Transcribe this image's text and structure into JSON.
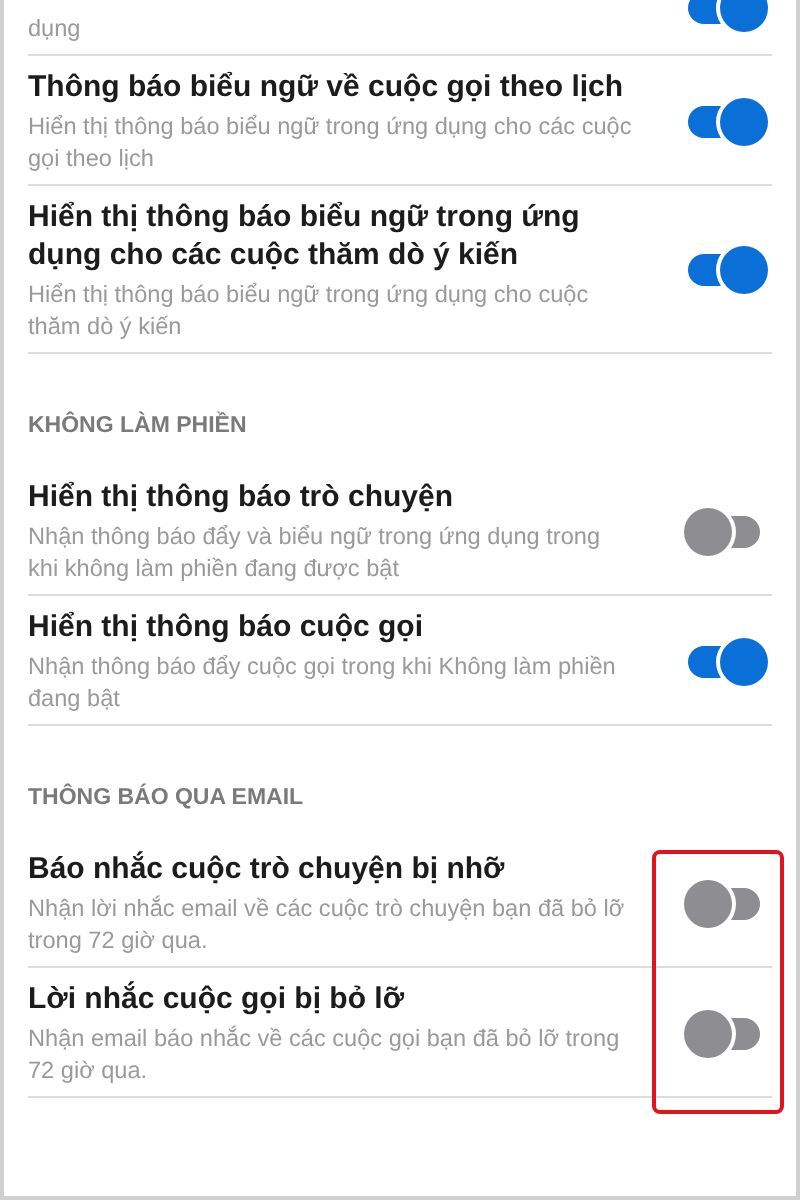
{
  "sections": [
    {
      "highlight_toggles": false,
      "rows": [
        {
          "title": null,
          "description": "dụng",
          "on": true
        },
        {
          "title": "Thông báo biểu ngữ về cuộc gọi theo lịch",
          "description": "Hiển thị thông báo biểu ngữ trong ứng dụng cho các cuộc gọi theo lịch",
          "on": true
        },
        {
          "title": "Hiển thị thông báo biểu ngữ trong ứng dụng cho các cuộc thăm dò ý kiến",
          "description": "Hiển thị thông báo biểu ngữ trong ứng dụng cho cuộc thăm dò ý kiến",
          "on": true
        }
      ]
    },
    {
      "header": "KHÔNG LÀM PHIỀN",
      "highlight_toggles": false,
      "rows": [
        {
          "title": "Hiển thị thông báo trò chuyện",
          "description": "Nhận thông báo đẩy và biểu ngữ trong ứng dụng trong khi không làm phiền đang được bật",
          "on": false
        },
        {
          "title": "Hiển thị thông báo cuộc gọi",
          "description": "Nhận thông báo đẩy cuộc gọi trong khi Không làm phiền đang bật",
          "on": true
        }
      ]
    },
    {
      "header": "THÔNG BÁO QUA EMAIL",
      "highlight_toggles": true,
      "rows": [
        {
          "title": "Báo nhắc cuộc trò chuyện bị nhỡ",
          "description": "Nhận lời nhắc email về các cuộc trò chuyện bạn đã bỏ lỡ trong 72 giờ qua.",
          "on": false
        },
        {
          "title": "Lời nhắc cuộc gọi bị bỏ lỡ",
          "description": "Nhận email báo nhắc về các cuộc gọi bạn đã bỏ lỡ trong 72 giờ qua.",
          "on": false
        }
      ]
    }
  ]
}
